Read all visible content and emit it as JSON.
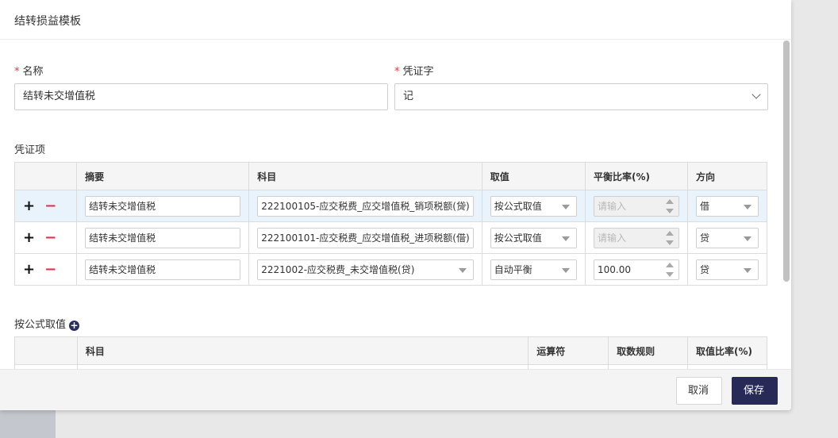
{
  "modal": {
    "title": "结转损益模板"
  },
  "form": {
    "name_label": "名称",
    "name_value": "结转未交增值税",
    "voucher_word_label": "凭证字",
    "voucher_word_value": "记",
    "required_mark": "*"
  },
  "voucher_items": {
    "section_title": "凭证项",
    "headers": [
      "",
      "摘要",
      "科目",
      "取值",
      "平衡比率(%)",
      "方向"
    ],
    "rows": [
      {
        "summary": "结转未交增值税",
        "account": "222100105-应交税费_应交增值税_销项税额(贷)",
        "value_type": "按公式取值",
        "ratio": "请输入",
        "ratio_disabled": true,
        "direction": "借"
      },
      {
        "summary": "结转未交增值税",
        "account": "222100101-应交税费_应交增值税_进项税额(借)",
        "value_type": "按公式取值",
        "ratio": "请输入",
        "ratio_disabled": true,
        "direction": "贷"
      },
      {
        "summary": "结转未交增值税",
        "account": "2221002-应交税费_未交增值税(贷)",
        "value_type": "自动平衡",
        "ratio": "100.00",
        "ratio_disabled": false,
        "direction": "贷"
      }
    ],
    "add_symbol": "+",
    "remove_symbol": "−"
  },
  "formula": {
    "section_title": "按公式取值",
    "add_icon": "plus-circle-icon",
    "headers": [
      "",
      "科目",
      "运算符",
      "取数规则",
      "取值比率(%)"
    ]
  },
  "footer": {
    "cancel_label": "取消",
    "save_label": "保存"
  },
  "colors": {
    "primary": "#272a57",
    "remove": "#e0304e",
    "required": "#e23b3b",
    "row_highlight": "#e8f3fc"
  }
}
